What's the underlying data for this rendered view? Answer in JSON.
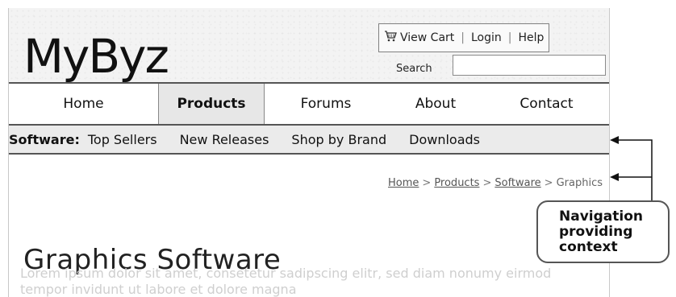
{
  "logo": {
    "text": "MyByz"
  },
  "utility": {
    "cart_icon": "cart-icon",
    "view_cart": "View Cart",
    "login": "Login",
    "help": "Help",
    "separator": "|"
  },
  "search": {
    "label": "Search",
    "value": ""
  },
  "main_nav": {
    "items": [
      {
        "label": "Home"
      },
      {
        "label": "Products",
        "active": true
      },
      {
        "label": "Forums"
      },
      {
        "label": "About"
      },
      {
        "label": "Contact"
      }
    ]
  },
  "sub_nav": {
    "label": "Software:",
    "links": [
      "Top Sellers",
      "New Releases",
      "Shop by Brand",
      "Downloads"
    ]
  },
  "breadcrumb": {
    "items": [
      "Home",
      "Products",
      "Software"
    ],
    "current": "Graphics",
    "separator": ">"
  },
  "main": {
    "title": "Graphics Software",
    "body": "Lorem ipsum dolor sit amet, consetetur sadipscing elitr, sed diam nonumy eirmod tempor invidunt ut labore et dolore magna"
  },
  "annotation": {
    "text": "Navigation\nproviding\ncontext"
  },
  "colors": {
    "annotation_border": "#555555",
    "subnav_bg": "#ebebeb",
    "active_tab_bg": "#e7e7e7"
  }
}
